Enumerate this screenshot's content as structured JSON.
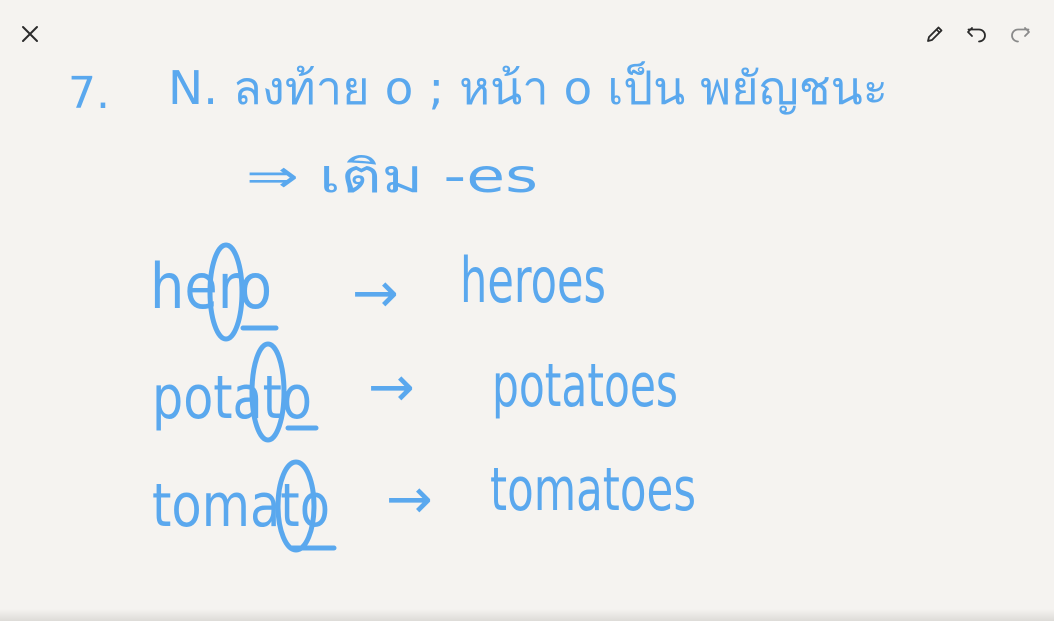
{
  "toolbar": {
    "close_icon": "close-icon",
    "pen_icon": "pencil-icon",
    "undo_icon": "undo-icon",
    "redo_icon": "redo-icon"
  },
  "note": {
    "ink_color": "#5aa8ee",
    "rule_number": "7.",
    "rule_line": "N. ลงท้าย o ; หน้า o เป็น พยัญชนะ",
    "rule_result": "⇒ เติม -es",
    "examples": [
      {
        "word": "hero",
        "arrow": "→",
        "plural": "heroes"
      },
      {
        "word": "potato",
        "arrow": "→",
        "plural": "potatoes"
      },
      {
        "word": "tomato",
        "arrow": "→",
        "plural": "tomatoes"
      }
    ]
  }
}
